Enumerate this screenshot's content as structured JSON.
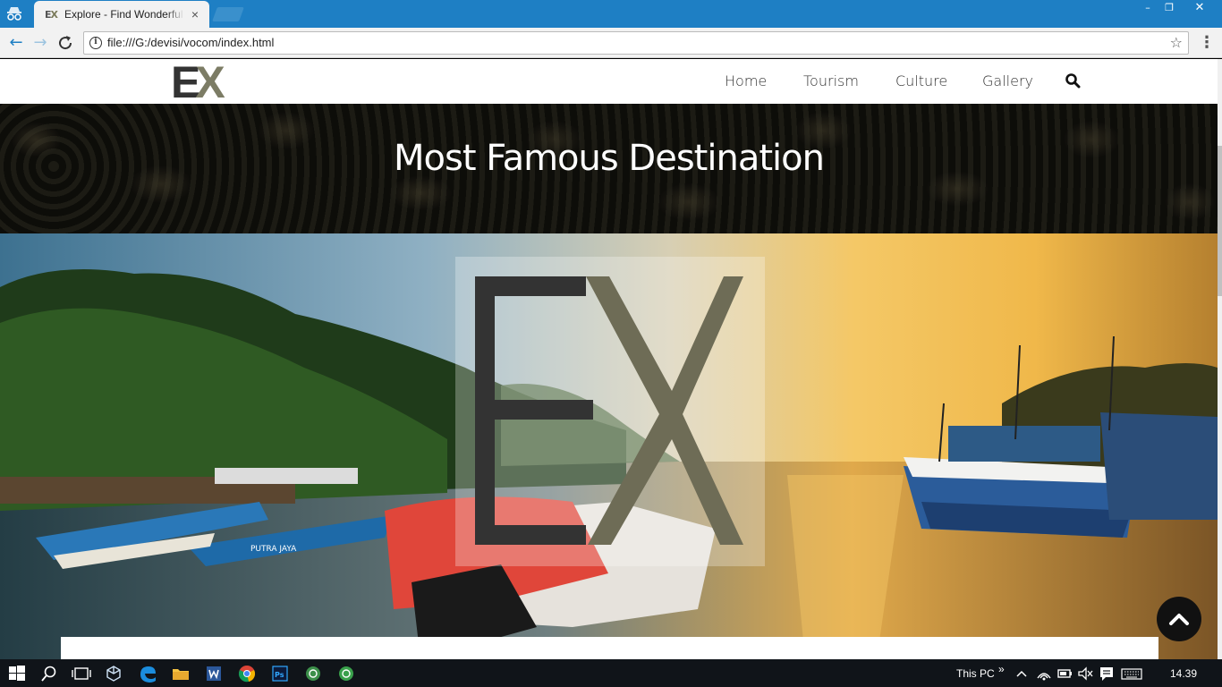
{
  "browser": {
    "tab_title": "Explore - Find Wonderful",
    "tab_favicon": "EX",
    "tab_close": "×",
    "url": "file:///G:/devisi/vocom/index.html",
    "window_min": "–",
    "window_max": "❐",
    "window_close": "✕"
  },
  "site": {
    "logo": "EX",
    "nav": [
      "Home",
      "Tourism",
      "Culture",
      "Gallery"
    ],
    "search_icon": "search-icon",
    "heading": "Most Famous Destination",
    "hero_overlay_logo": "EX",
    "boat_label": "PUTRA JAYA"
  },
  "taskbar": {
    "tray_label": "This PC",
    "tray_chevron": "»",
    "clock": "14.39"
  },
  "colors": {
    "chrome_blue": "#1e7fc4",
    "logo_dark": "#333333",
    "logo_olive": "#7c7c65",
    "taskbar": "#101419"
  }
}
